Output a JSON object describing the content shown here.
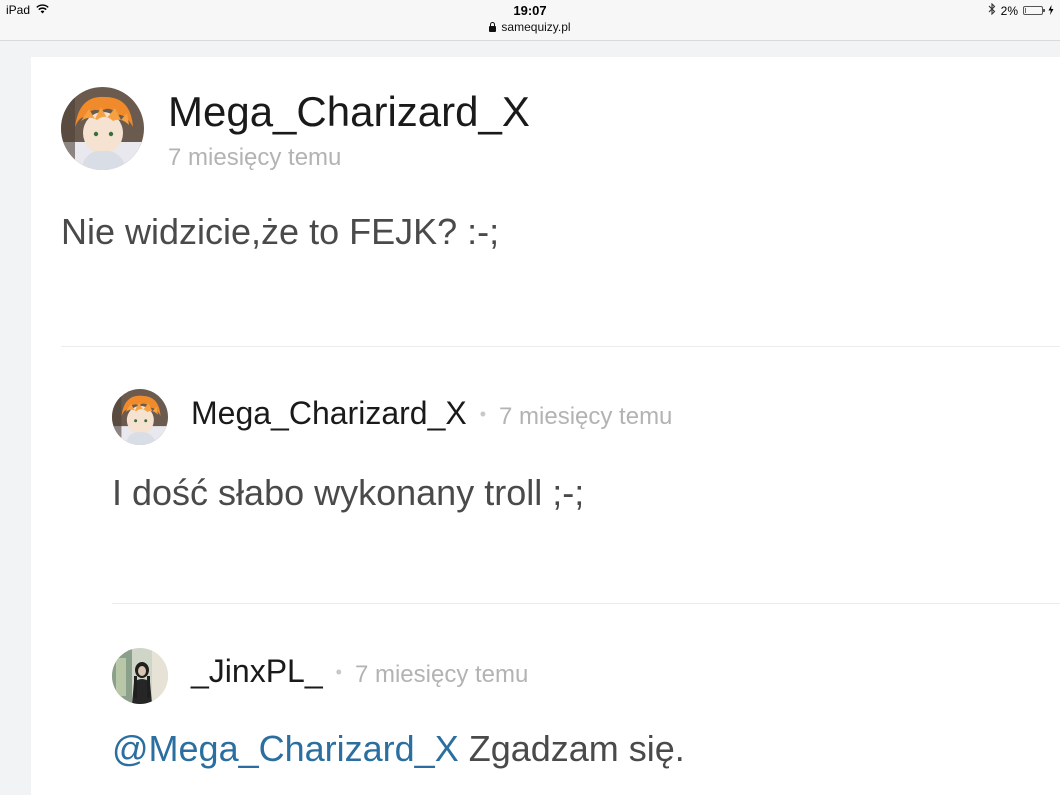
{
  "status_bar": {
    "device": "iPad",
    "time": "19:07",
    "url": "samequizy.pl",
    "battery_percent": "2%",
    "battery_level": 0.02
  },
  "comments": [
    {
      "author": "Mega_Charizard_X",
      "time": "7 miesięcy temu",
      "text": "Nie widzicie,że to FEJK? :-;"
    }
  ],
  "replies": [
    {
      "author": "Mega_Charizard_X",
      "separator": "•",
      "time": "7 miesięcy temu",
      "text": "I dość słabo wykonany troll ;-;"
    },
    {
      "author": "_JinxPL_",
      "separator": "•",
      "time": "7 miesięcy temu",
      "mention": "@Mega_Charizard_X",
      "text": " Zgadzam się."
    }
  ],
  "colors": {
    "mention": "#2a6fa0",
    "meta_gray": "#b3b3b3",
    "battery_low": "#e53935"
  }
}
